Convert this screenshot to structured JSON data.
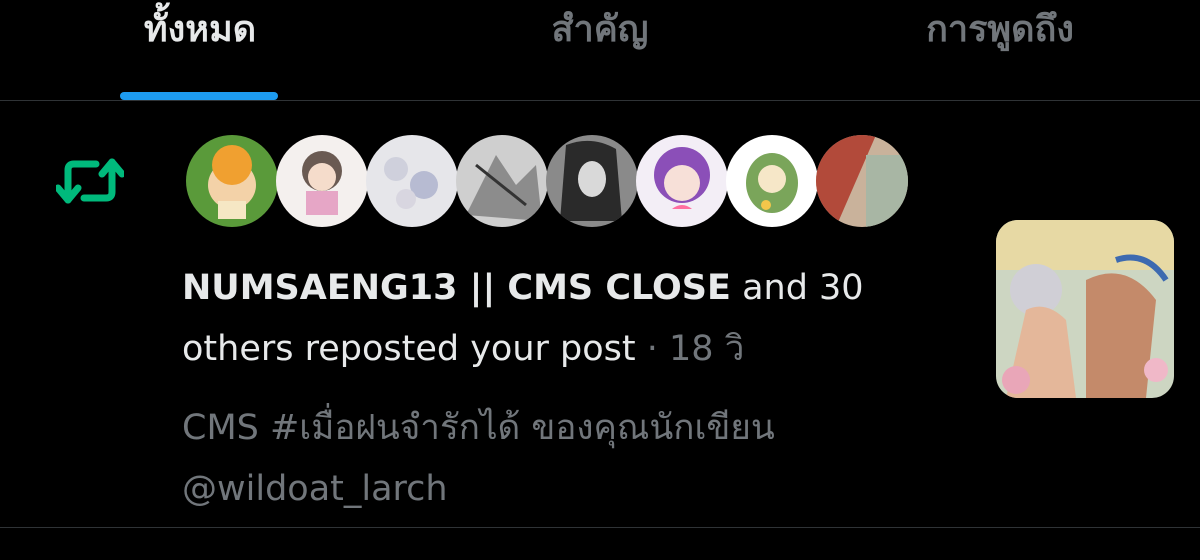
{
  "tabs": [
    {
      "label": "ทั้งหมด",
      "active": true
    },
    {
      "label": "สำคัญ",
      "active": false
    },
    {
      "label": "การพูดถึง",
      "active": false
    }
  ],
  "notification": {
    "icon": "repost-icon",
    "icon_color": "#00ba7c",
    "actor_name": "NUMSAENG13 || CMS CLOSE",
    "action_text": " and 30 others reposted your post",
    "separator": " · ",
    "time": "18 วิ",
    "post_preview_line1": "CMS #เมื่อฝนจำรักได้ ของคุณนักเขียน",
    "post_preview_line2": "@wildoat_larch",
    "avatars": [
      "avatar-chibi-green",
      "avatar-chibi-dark-hair",
      "avatar-pale-flowers",
      "avatar-sketch",
      "avatar-dark-portrait",
      "avatar-purple-chibi",
      "avatar-green-dino",
      "avatar-red-hair"
    ]
  },
  "colors": {
    "background": "#000000",
    "text_primary": "#e7e9ea",
    "text_secondary": "#71767b",
    "accent": "#1d9bf0",
    "divider": "#2f3336"
  }
}
